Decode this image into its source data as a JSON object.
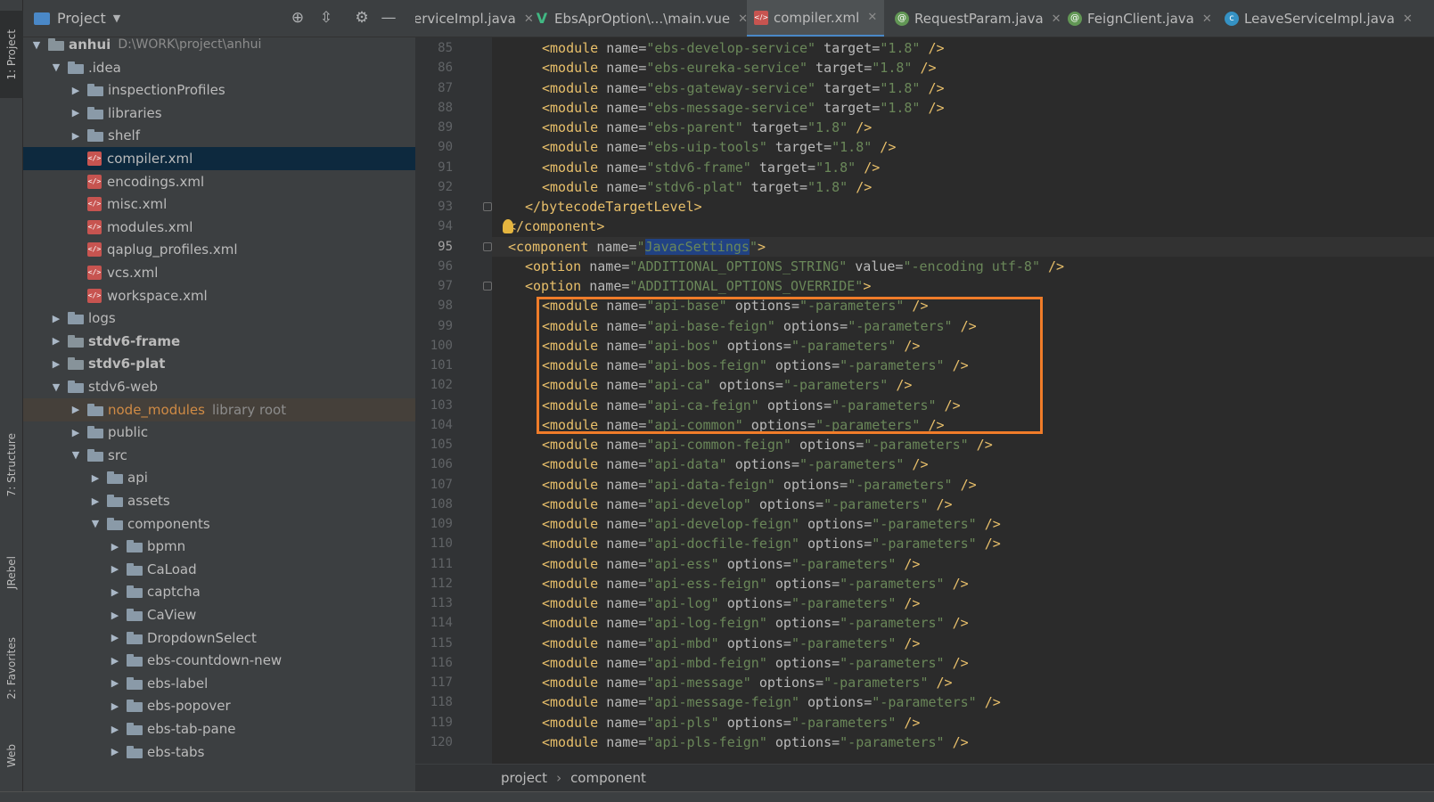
{
  "side_tabs": {
    "project": "1: Project",
    "structure": "7: Structure",
    "jrebel": "JRebel",
    "favorites": "2: Favorites",
    "web": "Web"
  },
  "project_panel": {
    "title": "Project"
  },
  "tree": [
    {
      "label": "anhui",
      "path": "D:\\WORK\\project\\anhui",
      "kind": "module",
      "arrow": "▼",
      "bold": true
    },
    {
      "label": ".idea",
      "kind": "folder",
      "arrow": "▼"
    },
    {
      "label": "inspectionProfiles",
      "kind": "folder",
      "arrow": "▶"
    },
    {
      "label": "libraries",
      "kind": "folder",
      "arrow": "▶"
    },
    {
      "label": "shelf",
      "kind": "folder",
      "arrow": "▶"
    },
    {
      "label": "compiler.xml",
      "kind": "xml",
      "selected": true
    },
    {
      "label": "encodings.xml",
      "kind": "xml"
    },
    {
      "label": "misc.xml",
      "kind": "xml"
    },
    {
      "label": "modules.xml",
      "kind": "xml"
    },
    {
      "label": "qaplug_profiles.xml",
      "kind": "xml"
    },
    {
      "label": "vcs.xml",
      "kind": "xml"
    },
    {
      "label": "workspace.xml",
      "kind": "xml"
    },
    {
      "label": "logs",
      "kind": "folder",
      "arrow": "▶"
    },
    {
      "label": "stdv6-frame",
      "kind": "module",
      "arrow": "▶",
      "bold": true
    },
    {
      "label": "stdv6-plat",
      "kind": "module",
      "arrow": "▶",
      "bold": true
    },
    {
      "label": "stdv6-web",
      "kind": "folder",
      "arrow": "▼"
    },
    {
      "label": "node_modules",
      "lib": "library root",
      "kind": "folder",
      "arrow": "▶",
      "highlight": true
    },
    {
      "label": "public",
      "kind": "folder",
      "arrow": "▶"
    },
    {
      "label": "src",
      "kind": "folder",
      "arrow": "▼"
    },
    {
      "label": "api",
      "kind": "folder",
      "arrow": "▶"
    },
    {
      "label": "assets",
      "kind": "folder",
      "arrow": "▶"
    },
    {
      "label": "components",
      "kind": "folder",
      "arrow": "▼"
    },
    {
      "label": "bpmn",
      "kind": "folder",
      "arrow": "▶"
    },
    {
      "label": "CaLoad",
      "kind": "folder",
      "arrow": "▶"
    },
    {
      "label": "captcha",
      "kind": "folder",
      "arrow": "▶"
    },
    {
      "label": "CaView",
      "kind": "folder",
      "arrow": "▶"
    },
    {
      "label": "DropdownSelect",
      "kind": "folder",
      "arrow": "▶"
    },
    {
      "label": "ebs-countdown-new",
      "kind": "folder",
      "arrow": "▶"
    },
    {
      "label": "ebs-label",
      "kind": "folder",
      "arrow": "▶"
    },
    {
      "label": "ebs-popover",
      "kind": "folder",
      "arrow": "▶"
    },
    {
      "label": "ebs-tab-pane",
      "kind": "folder",
      "arrow": "▶"
    },
    {
      "label": "ebs-tabs",
      "kind": "folder",
      "arrow": "▶"
    }
  ],
  "tabs": [
    {
      "label": "erviceImpl.java",
      "icon": "class"
    },
    {
      "label": "EbsAprOption\\...\\main.vue",
      "icon": "vue"
    },
    {
      "label": "compiler.xml",
      "icon": "xml",
      "active": true
    },
    {
      "label": "RequestParam.java",
      "icon": "annotation"
    },
    {
      "label": "FeignClient.java",
      "icon": "annotation"
    },
    {
      "label": "LeaveServiceImpl.java",
      "icon": "class"
    }
  ],
  "code_lines": [
    {
      "n": "85",
      "ind": 2,
      "kind": "module-target",
      "name": "ebs-develop-service",
      "target": "1.8"
    },
    {
      "n": "86",
      "ind": 2,
      "kind": "module-target",
      "name": "ebs-eureka-service",
      "target": "1.8"
    },
    {
      "n": "87",
      "ind": 2,
      "kind": "module-target",
      "name": "ebs-gateway-service",
      "target": "1.8"
    },
    {
      "n": "88",
      "ind": 2,
      "kind": "module-target",
      "name": "ebs-message-service",
      "target": "1.8"
    },
    {
      "n": "89",
      "ind": 2,
      "kind": "module-target",
      "name": "ebs-parent",
      "target": "1.8"
    },
    {
      "n": "90",
      "ind": 2,
      "kind": "module-target",
      "name": "ebs-uip-tools",
      "target": "1.8"
    },
    {
      "n": "91",
      "ind": 2,
      "kind": "module-target",
      "name": "stdv6-frame",
      "target": "1.8"
    },
    {
      "n": "92",
      "ind": 2,
      "kind": "module-target",
      "name": "stdv6-plat",
      "target": "1.8"
    },
    {
      "n": "93",
      "ind": 1,
      "kind": "raw",
      "text": "</bytecodeTargetLevel>"
    },
    {
      "n": "94",
      "ind": 0,
      "kind": "raw",
      "text": "</component>"
    },
    {
      "n": "95",
      "ind": 0,
      "kind": "component",
      "name": "JavacSettings",
      "current": true
    },
    {
      "n": "96",
      "ind": 1,
      "kind": "option-value",
      "name": "ADDITIONAL_OPTIONS_STRING",
      "value": "-encoding utf-8"
    },
    {
      "n": "97",
      "ind": 1,
      "kind": "option-open",
      "name": "ADDITIONAL_OPTIONS_OVERRIDE"
    },
    {
      "n": "98",
      "ind": 2,
      "kind": "module-options",
      "name": "api-base",
      "options": "-parameters"
    },
    {
      "n": "99",
      "ind": 2,
      "kind": "module-options",
      "name": "api-base-feign",
      "options": "-parameters"
    },
    {
      "n": "100",
      "ind": 2,
      "kind": "module-options",
      "name": "api-bos",
      "options": "-parameters"
    },
    {
      "n": "101",
      "ind": 2,
      "kind": "module-options",
      "name": "api-bos-feign",
      "options": "-parameters"
    },
    {
      "n": "102",
      "ind": 2,
      "kind": "module-options",
      "name": "api-ca",
      "options": "-parameters"
    },
    {
      "n": "103",
      "ind": 2,
      "kind": "module-options",
      "name": "api-ca-feign",
      "options": "-parameters"
    },
    {
      "n": "104",
      "ind": 2,
      "kind": "module-options",
      "name": "api-common",
      "options": "-parameters"
    },
    {
      "n": "105",
      "ind": 2,
      "kind": "module-options",
      "name": "api-common-feign",
      "options": "-parameters"
    },
    {
      "n": "106",
      "ind": 2,
      "kind": "module-options",
      "name": "api-data",
      "options": "-parameters"
    },
    {
      "n": "107",
      "ind": 2,
      "kind": "module-options",
      "name": "api-data-feign",
      "options": "-parameters"
    },
    {
      "n": "108",
      "ind": 2,
      "kind": "module-options",
      "name": "api-develop",
      "options": "-parameters"
    },
    {
      "n": "109",
      "ind": 2,
      "kind": "module-options",
      "name": "api-develop-feign",
      "options": "-parameters"
    },
    {
      "n": "110",
      "ind": 2,
      "kind": "module-options",
      "name": "api-docfile-feign",
      "options": "-parameters"
    },
    {
      "n": "111",
      "ind": 2,
      "kind": "module-options",
      "name": "api-ess",
      "options": "-parameters"
    },
    {
      "n": "112",
      "ind": 2,
      "kind": "module-options",
      "name": "api-ess-feign",
      "options": "-parameters"
    },
    {
      "n": "113",
      "ind": 2,
      "kind": "module-options",
      "name": "api-log",
      "options": "-parameters"
    },
    {
      "n": "114",
      "ind": 2,
      "kind": "module-options",
      "name": "api-log-feign",
      "options": "-parameters"
    },
    {
      "n": "115",
      "ind": 2,
      "kind": "module-options",
      "name": "api-mbd",
      "options": "-parameters"
    },
    {
      "n": "116",
      "ind": 2,
      "kind": "module-options",
      "name": "api-mbd-feign",
      "options": "-parameters"
    },
    {
      "n": "117",
      "ind": 2,
      "kind": "module-options",
      "name": "api-message",
      "options": "-parameters"
    },
    {
      "n": "118",
      "ind": 2,
      "kind": "module-options",
      "name": "api-message-feign",
      "options": "-parameters"
    },
    {
      "n": "119",
      "ind": 2,
      "kind": "module-options",
      "name": "api-pls",
      "options": "-parameters"
    },
    {
      "n": "120",
      "ind": 2,
      "kind": "module-options",
      "name": "api-pls-feign",
      "options": "-parameters"
    }
  ],
  "breadcrumb": [
    "project",
    "component"
  ],
  "colors": {
    "tag": "#e8bf6a",
    "attr": "#bababa",
    "value": "#6a8759",
    "highlight_box": "#f07c29",
    "selection": "#214283"
  }
}
